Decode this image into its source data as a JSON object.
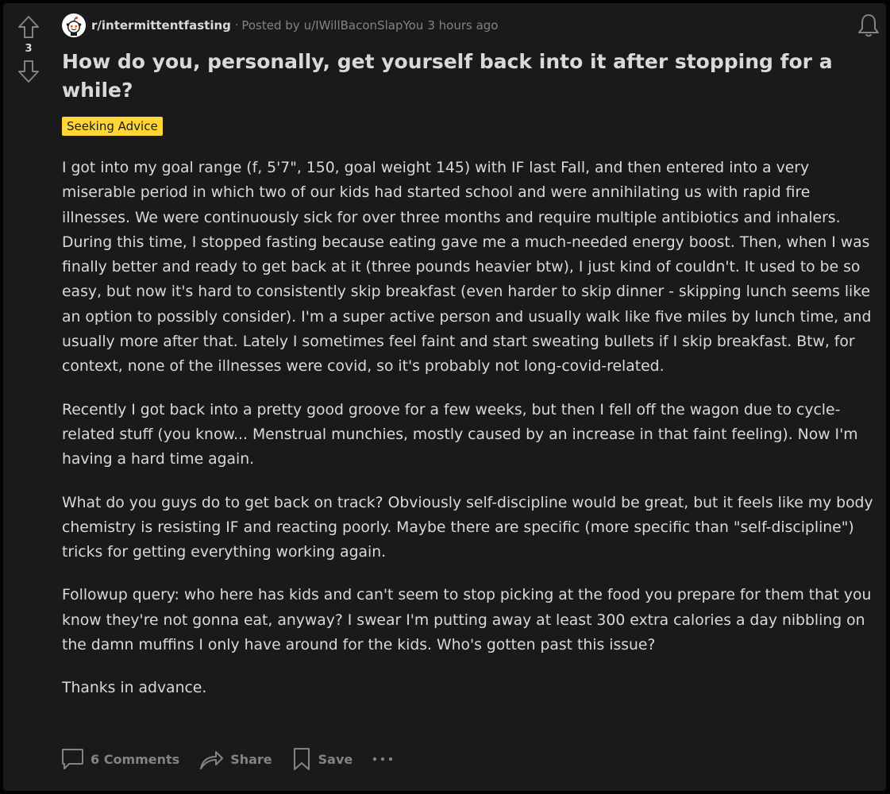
{
  "vote": {
    "score": "3",
    "upvote_icon": "arrow-up-outline-icon",
    "downvote_icon": "arrow-down-outline-icon"
  },
  "meta": {
    "subreddit": "r/intermittentfasting",
    "separator": "·",
    "posted_by": "Posted by",
    "author": "u/IWillBaconSlapYou",
    "time": "3 hours ago"
  },
  "post": {
    "title": "How do you, personally, get yourself back into it after stopping for a while?",
    "flair": "Seeking Advice",
    "flair_color": "#ffd635",
    "paragraphs": [
      "I got into my goal range (f, 5'7\", 150, goal weight 145) with IF last Fall, and then entered into a very miserable period in which two of our kids had started school and were annihilating us with rapid fire illnesses. We were continuously sick for over three months and require multiple antibiotics and inhalers. During this time, I stopped fasting because eating gave me a much-needed energy boost. Then, when I was finally better and ready to get back at it (three pounds heavier btw), I just kind of couldn't. It used to be so easy, but now it's hard to consistently skip breakfast (even harder to skip dinner - skipping lunch seems like an option to possibly consider). I'm a super active person and usually walk like five miles by lunch time, and usually more after that. Lately I sometimes feel faint and start sweating bullets if I skip breakfast. Btw, for context, none of the illnesses were covid, so it's probably not long-covid-related.",
      "Recently I got back into a pretty good groove for a few weeks, but then I fell off the wagon due to cycle-related stuff (you know... Menstrual munchies, mostly caused by an increase in that faint feeling). Now I'm having a hard time again.",
      "What do you guys do to get back on track? Obviously self-discipline would be great, but it feels like my body chemistry is resisting IF and reacting poorly. Maybe there are specific (more specific than \"self-discipline\") tricks for getting everything working again.",
      "Followup query: who here has kids and can't seem to stop picking at the food you prepare for them that you know they're not gonna eat, anyway? I swear I'm putting away at least 300 extra calories a day nibbling on the damn muffins I only have around for the kids. Who's gotten past this issue?",
      "Thanks in advance."
    ]
  },
  "actions": {
    "comments": "6 Comments",
    "share": "Share",
    "save": "Save"
  },
  "colors": {
    "background": "#030303",
    "card": "#1a1a1b",
    "text": "#d7dadc",
    "muted": "#818384"
  }
}
